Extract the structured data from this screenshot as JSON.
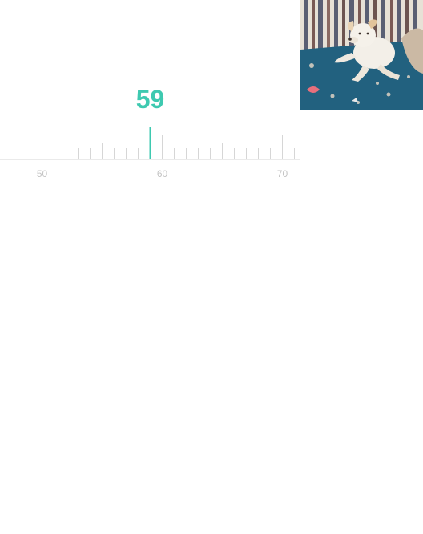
{
  "picker": {
    "value": "59",
    "current_value": 59,
    "scale_min": 45,
    "scale_max": 71,
    "major_step": 10,
    "mid_step": 5,
    "minor_step": 1,
    "labels": [
      "50",
      "60",
      "70"
    ],
    "accent_color": "#3ec9b0",
    "tick_color": "#d6d6d6",
    "label_color": "#c4c4c4"
  },
  "photo": {
    "subject": "dog-on-sofa-photo"
  }
}
